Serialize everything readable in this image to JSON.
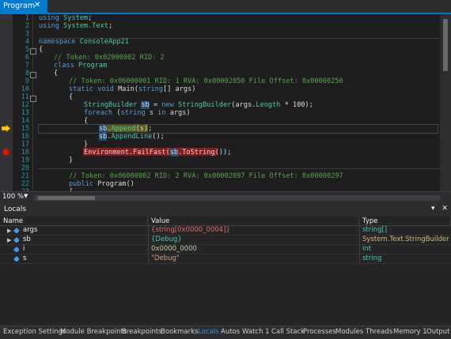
{
  "document": {
    "tab_label": "Program",
    "close_glyph": "✕"
  },
  "editor": {
    "line_numbers": [
      "1",
      "2",
      "3",
      "4",
      "5",
      "6",
      "7",
      "8",
      "9",
      "10",
      "11",
      "12",
      "13",
      "14",
      "15",
      "16",
      "17",
      "18",
      "19",
      "20",
      "21",
      "22",
      "23"
    ],
    "lines": {
      "l1": [
        "using ",
        "System",
        ";"
      ],
      "l2": [
        "using ",
        "System.Text",
        ";"
      ],
      "l4": [
        "namespace ",
        "ConsoleApp21"
      ],
      "l5": "{",
      "l6": "// Token: 0x02000002 RID: 2",
      "l7": [
        "class ",
        "Program"
      ],
      "l8": "{",
      "l9": "// Token: 0x06000001 RID: 1 RVA: 0x00002050 File Offset: 0x00000250",
      "l10": [
        "static void ",
        "Main",
        "(",
        "string",
        "[] args)"
      ],
      "l11": "{",
      "l12": [
        "StringBuilder ",
        "sb",
        " = ",
        "new ",
        "StringBuilder",
        "(args.",
        "Length",
        " * 100);"
      ],
      "l13": [
        "foreach ",
        "(",
        "string ",
        "s ",
        "in ",
        "args)"
      ],
      "l14": "{",
      "l15": [
        "sb",
        ".",
        "Append",
        "(s);"
      ],
      "l16": [
        "sb",
        ".",
        "AppendLine",
        "();"
      ],
      "l17": "}",
      "l18": [
        "Environment",
        ".",
        "FailFast",
        "(",
        "sb",
        ".",
        "ToString",
        "());"
      ],
      "l19": "}",
      "l21": "// Token: 0x06000002 RID: 2 RVA: 0x00002097 File Offset: 0x00000297",
      "l22": [
        "public ",
        "Program",
        "()"
      ],
      "l23": "{"
    }
  },
  "zoom": {
    "level": "100 %",
    "arrow": "▼"
  },
  "locals": {
    "title": "Locals",
    "pin_glyph": "▾",
    "close_glyph": "✕",
    "columns": [
      "Name",
      "Value",
      "Type"
    ],
    "rows": [
      {
        "name": "args",
        "value": "{string[0x0000_0004]}",
        "type": "string[]"
      },
      {
        "name": "sb",
        "value": "{Debug}",
        "type": "System.Text.StringBuilder"
      },
      {
        "name": "i",
        "value": "0x0000_0000",
        "type": "int"
      },
      {
        "name": "s",
        "value": "\"Debug\"",
        "type": "string"
      }
    ]
  },
  "bottom_tabs": [
    "Exception Settings",
    "Module Breakpoints",
    "Breakpoints",
    "Bookmarks",
    "Locals",
    "Autos",
    "Watch 1",
    "Call Stack",
    "Processes",
    "Modules",
    "Threads",
    "Memory 1",
    "Output"
  ],
  "active_bottom_tab": "Locals",
  "colors": {
    "accent": "#007acc",
    "breakpoint": "#e51400",
    "current_statement": "#ffcc00"
  }
}
